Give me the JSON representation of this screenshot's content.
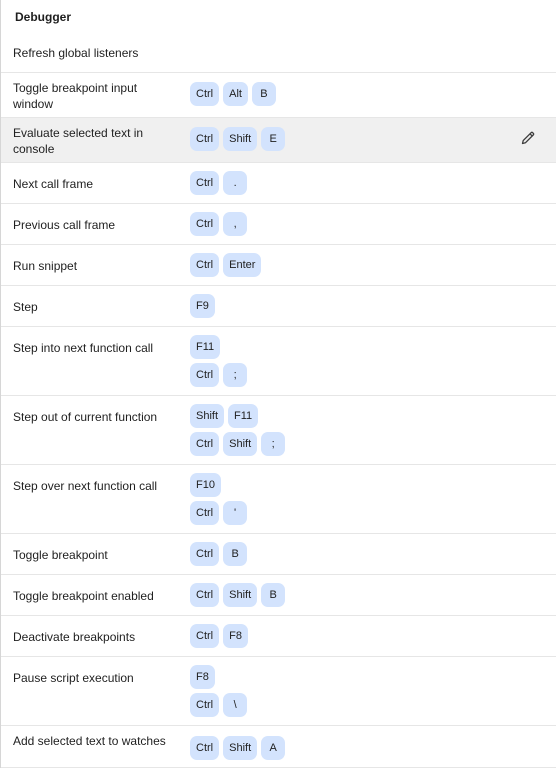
{
  "section": {
    "title": "Debugger"
  },
  "rows": [
    {
      "label": "Refresh global listeners",
      "combos": []
    },
    {
      "label": "Toggle breakpoint input window",
      "combos": [
        [
          "Ctrl",
          "Alt",
          "B"
        ]
      ]
    },
    {
      "label": "Evaluate selected text in console",
      "combos": [
        [
          "Ctrl",
          "Shift",
          "E"
        ]
      ],
      "selected": true,
      "edit_icon": "pencil-icon"
    },
    {
      "label": "Next call frame",
      "combos": [
        [
          "Ctrl",
          "."
        ]
      ]
    },
    {
      "label": "Previous call frame",
      "combos": [
        [
          "Ctrl",
          ","
        ]
      ]
    },
    {
      "label": "Run snippet",
      "combos": [
        [
          "Ctrl",
          "Enter"
        ]
      ]
    },
    {
      "label": "Step",
      "combos": [
        [
          "F9"
        ]
      ]
    },
    {
      "label": "Step into next function call",
      "combos": [
        [
          "F11"
        ],
        [
          "Ctrl",
          ";"
        ]
      ]
    },
    {
      "label": "Step out of current function",
      "combos": [
        [
          "Shift",
          "F11"
        ],
        [
          "Ctrl",
          "Shift",
          ";"
        ]
      ]
    },
    {
      "label": "Step over next function call",
      "combos": [
        [
          "F10"
        ],
        [
          "Ctrl",
          "'"
        ]
      ]
    },
    {
      "label": "Toggle breakpoint",
      "combos": [
        [
          "Ctrl",
          "B"
        ]
      ]
    },
    {
      "label": "Toggle breakpoint enabled",
      "combos": [
        [
          "Ctrl",
          "Shift",
          "B"
        ]
      ]
    },
    {
      "label": "Deactivate breakpoints",
      "combos": [
        [
          "Ctrl",
          "F8"
        ]
      ]
    },
    {
      "label": "Pause script execution",
      "combos": [
        [
          "F8"
        ],
        [
          "Ctrl",
          "\\"
        ]
      ]
    },
    {
      "label": "Add selected text to watches",
      "combos": [
        [
          "Ctrl",
          "Shift",
          "A"
        ]
      ]
    }
  ],
  "colors": {
    "key_background": "#d3e3fd",
    "selected_row_background": "#f0f0f0",
    "divider": "#e6e6e6"
  }
}
